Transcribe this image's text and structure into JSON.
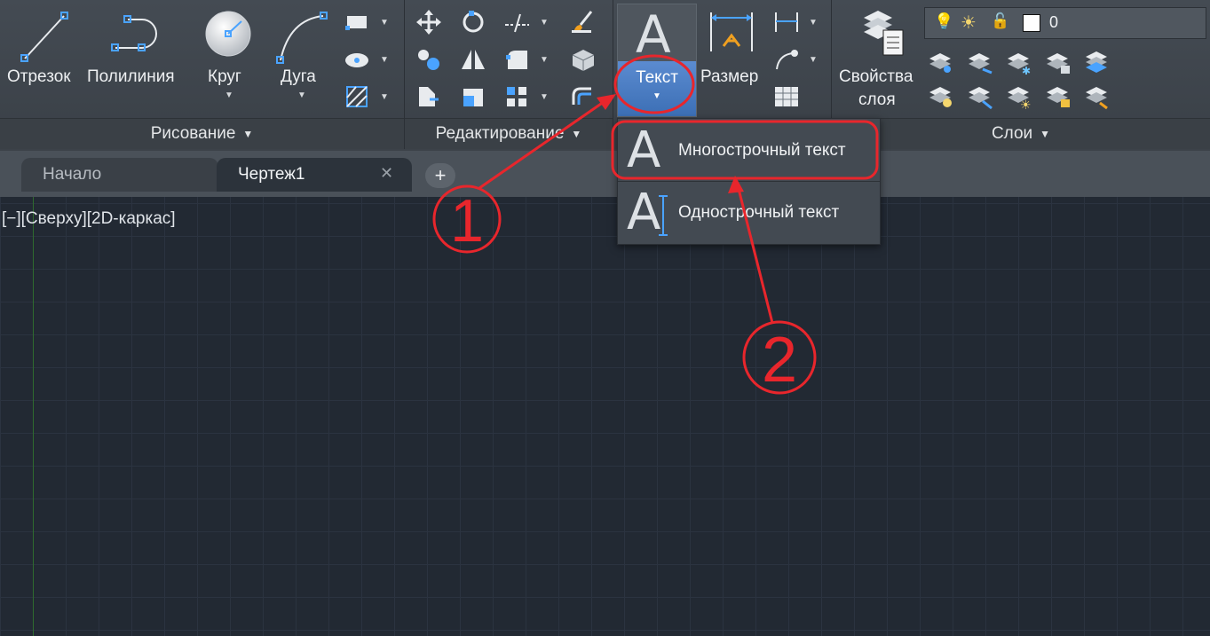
{
  "ribbon": {
    "draw_panel": {
      "title": "Рисование",
      "tools": {
        "line": "Отрезок",
        "polyline": "Полилиния",
        "circle": "Круг",
        "arc": "Дуга"
      }
    },
    "modify_panel": {
      "title": "Редактирование"
    },
    "annotation_panel": {
      "text_label": "Текст",
      "dimension_label": "Размер"
    },
    "layers_panel": {
      "title": "Слои",
      "layer_properties_line1": "Свойства",
      "layer_properties_line2": "слоя",
      "current_layer": "0"
    }
  },
  "tabs": [
    {
      "label": "Начало",
      "active": false
    },
    {
      "label": "Чертеж1",
      "active": true
    }
  ],
  "viewport_label": "[−][Сверху][2D-каркас]",
  "text_dropdown": {
    "items": [
      {
        "label": "Многострочный текст"
      },
      {
        "label": "Однострочный текст"
      }
    ]
  },
  "annotations": {
    "step1": "1",
    "step2": "2"
  },
  "colors": {
    "annotation": "#e8262c",
    "background": "#222933",
    "ribbon": "#3c4249"
  }
}
